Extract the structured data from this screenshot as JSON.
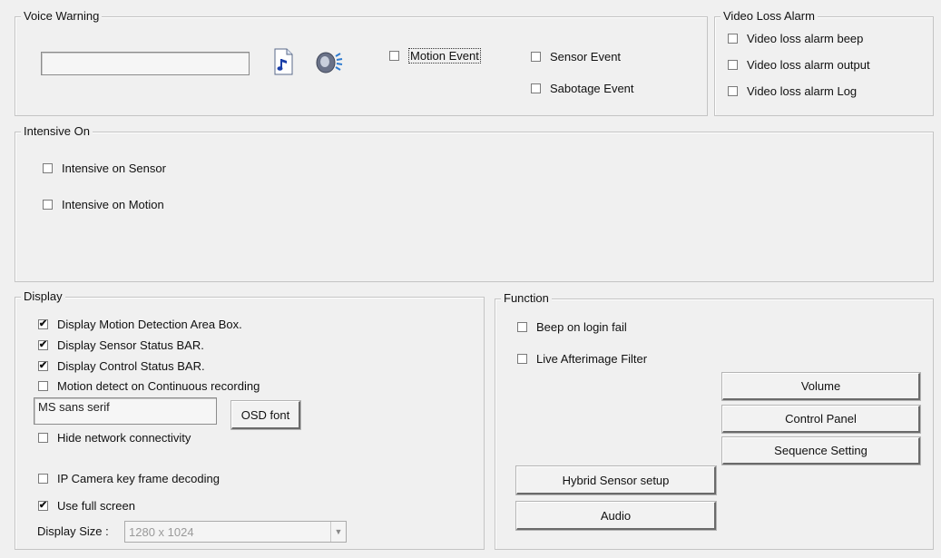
{
  "voice_warning": {
    "title": "Voice Warning",
    "file_value": "",
    "motion_event": {
      "label": "Motion Event",
      "checked": false
    },
    "sensor_event": {
      "label": "Sensor Event",
      "checked": false
    },
    "sabotage_event": {
      "label": "Sabotage Event",
      "checked": false
    }
  },
  "video_loss": {
    "title": "Video Loss Alarm",
    "items": [
      {
        "label": "Video loss alarm beep",
        "checked": false
      },
      {
        "label": "Video loss alarm output",
        "checked": false
      },
      {
        "label": "Video loss alarm Log",
        "checked": false
      }
    ]
  },
  "intensive": {
    "title": "Intensive On",
    "items": [
      {
        "label": "Intensive on Sensor",
        "checked": false
      },
      {
        "label": "Intensive on Motion",
        "checked": false
      }
    ]
  },
  "display": {
    "title": "Display",
    "items": [
      {
        "label": "Display Motion Detection Area Box.",
        "checked": true
      },
      {
        "label": "Display Sensor Status BAR.",
        "checked": true
      },
      {
        "label": "Display Control Status BAR.",
        "checked": true
      },
      {
        "label": "Motion detect on Continuous recording",
        "checked": false
      }
    ],
    "font_value": "MS sans serif",
    "osd_font_label": "OSD font",
    "hide_network": {
      "label": "Hide network connectivity",
      "checked": false
    },
    "ip_camera": {
      "label": "IP Camera key frame decoding",
      "checked": false
    },
    "full_screen": {
      "label": "Use full screen",
      "checked": true
    },
    "size_label": "Display Size :",
    "size_value": "1280 x 1024"
  },
  "function": {
    "title": "Function",
    "beep_login": {
      "label": "Beep on login fail",
      "checked": false
    },
    "afterimage": {
      "label": "Live Afterimage Filter",
      "checked": false
    },
    "volume_label": "Volume",
    "control_panel_label": "Control Panel",
    "sequence_label": "Sequence Setting",
    "hybrid_label": "Hybrid Sensor setup",
    "audio_label": "Audio"
  },
  "check_mark": "✔"
}
